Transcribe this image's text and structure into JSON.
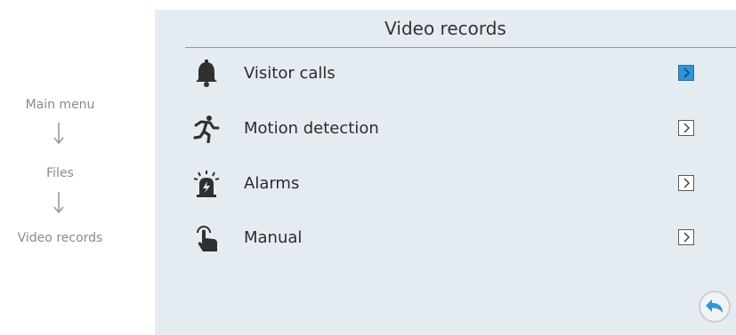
{
  "navigation_path": [
    "Main menu",
    "Files",
    "Video records"
  ],
  "screen": {
    "title": "Video records",
    "items": [
      {
        "label": "Visitor calls",
        "icon": "bell-icon",
        "selected": true
      },
      {
        "label": "Motion detection",
        "icon": "running-person-icon",
        "selected": false
      },
      {
        "label": "Alarms",
        "icon": "alarm-icon",
        "selected": false
      },
      {
        "label": "Manual",
        "icon": "hand-pointer-icon",
        "selected": false
      }
    ],
    "back_icon": "back-arrow-icon"
  },
  "colors": {
    "screen_background": "#e4ecf1",
    "selected_accent": "#2e95d8",
    "icon": "#2f2f2f",
    "path_text": "#8a8a8a"
  }
}
